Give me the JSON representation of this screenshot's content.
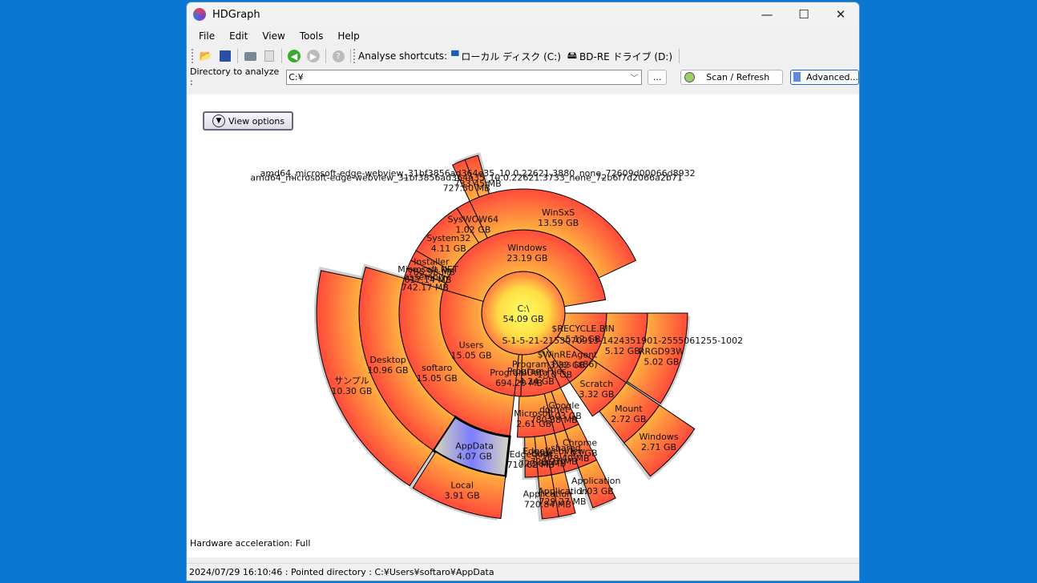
{
  "window": {
    "title": "HDGraph",
    "controls": [
      "—",
      "☐",
      "✕"
    ]
  },
  "menu": [
    "File",
    "Edit",
    "View",
    "Tools",
    "Help"
  ],
  "toolbar": {
    "icons": [
      "open-folder-icon",
      "save-icon",
      "print-icon",
      "print-preview-icon",
      "back-icon",
      "forward-icon",
      "help-icon"
    ],
    "shortcuts_label": "Analyse shortcuts:",
    "shortcut_local": "ローカル ディスク (C:)",
    "shortcut_bd": "BD-RE ドライブ (D:)"
  },
  "directory": {
    "label": "Directory to analyze :",
    "value": "C:¥",
    "browse": "...",
    "scan": "Scan / Refresh",
    "advanced": "Advanced..."
  },
  "view_options": "View options",
  "hardware": "Hardware acceleration: Full",
  "status": "2024/07/29 16:10:46 : Pointed directory : C:¥Users¥softaro¥AppData",
  "chart_data": {
    "type": "sunburst",
    "unit_total_gb": 54.09,
    "highlight": "AppData",
    "colors": {
      "inner": "#ffff66",
      "ring_in": "#ffb040",
      "ring_out": "#ff4a3a",
      "highlight": "#7d7dff",
      "shadow": "#a0a0a0"
    },
    "root": {
      "name": "C:\\",
      "size": "54.09 GB",
      "gb": 54.09,
      "children": [
        {
          "name": "$RECYCLE.BIN",
          "size": "5.12 GB",
          "gb": 5.12,
          "children": [
            {
              "name": "S-1-5-21-2153070913-1424351901-2555061255-1002",
              "size": "5.12 GB",
              "gb": 5.12,
              "children": [
                {
                  "name": "RRGD93W",
                  "size": "5.02 GB",
                  "gb": 5.02,
                  "children": []
                }
              ]
            }
          ]
        },
        {
          "name": "$WinREAgent",
          "size": "3.32 GB",
          "gb": 3.32,
          "children": [
            {
              "name": "Scratch",
              "size": "3.32 GB",
              "gb": 3.32,
              "children": [
                {
                  "name": "Mount",
                  "size": "2.72 GB",
                  "gb": 2.72,
                  "children": [
                    {
                      "name": "Windows",
                      "size": "2.71 GB",
                      "gb": 2.71,
                      "children": []
                    }
                  ]
                }
              ]
            }
          ]
        },
        {
          "name": "Program Files (x86)",
          "size": "1.10 GB",
          "gb": 1.1,
          "children": []
        },
        {
          "name": "Program Files",
          "size": "4.24 GB",
          "gb": 4.24,
          "children": [
            {
              "name": "Google",
              "size": "1.03 GB",
              "gb": 1.03,
              "children": [
                {
                  "name": "Chrome",
                  "size": "1.03 GB",
                  "gb": 1.03,
                  "children": [
                    {
                      "name": "Application",
                      "size": "1.03 GB",
                      "gb": 1.03,
                      "children": []
                    }
                  ]
                }
              ]
            },
            {
              "name": "dotnet",
              "size": "780.38 MB",
              "gb": 0.76,
              "children": [
                {
                  "name": "shared",
                  "size": "778.40 MB",
                  "gb": 0.76,
                  "children": []
                }
              ]
            },
            {
              "name": "Microsoft",
              "size": "2.61 GB",
              "gb": 2.61,
              "children": [
                {
                  "name": "EdgeWebView",
                  "size": "729.27 MB",
                  "gb": 0.71,
                  "children": [
                    {
                      "name": "Application",
                      "size": "729.27 MB",
                      "gb": 0.71,
                      "children": []
                    }
                  ]
                },
                {
                  "name": "Edge",
                  "size": "720.84 MB",
                  "gb": 0.7,
                  "children": [
                    {
                      "name": "Application",
                      "size": "720.84 MB",
                      "gb": 0.7,
                      "children": []
                    }
                  ]
                },
                {
                  "name": "EdgeCore",
                  "size": "710.62 MB",
                  "gb": 0.69,
                  "children": []
                }
              ]
            }
          ]
        },
        {
          "name": "ProgramData",
          "size": "694.20 MB",
          "gb": 0.68,
          "children": []
        },
        {
          "name": "Users",
          "size": "15.05 GB",
          "gb": 15.05,
          "children": [
            {
              "name": "softaro",
              "size": "15.05 GB",
              "gb": 15.05,
              "children": [
                {
                  "name": "AppData",
                  "size": "4.07 GB",
                  "gb": 4.07,
                  "children": [
                    {
                      "name": "Local",
                      "size": "3.91 GB",
                      "gb": 3.91,
                      "children": []
                    }
                  ]
                },
                {
                  "name": "Desktop",
                  "size": "10.96 GB",
                  "gb": 10.96,
                  "children": [
                    {
                      "name": "サンプル",
                      "size": "10.30 GB",
                      "gb": 10.3,
                      "children": []
                    }
                  ]
                }
              ]
            }
          ]
        },
        {
          "name": "Windows",
          "size": "23.19 GB",
          "gb": 23.19,
          "children": [
            {
              "name": "assembly",
              "size": "742.17 MB",
              "gb": 0.72,
              "children": []
            },
            {
              "name": "Microsoft.NET",
              "size": "617.14 MB",
              "gb": 0.6,
              "children": []
            },
            {
              "name": "Installer",
              "size": "785.98 MB",
              "gb": 0.77,
              "children": []
            },
            {
              "name": "System32",
              "size": "4.11 GB",
              "gb": 4.11,
              "children": []
            },
            {
              "name": "SysWOW64",
              "size": "1.02 GB",
              "gb": 1.02,
              "children": []
            },
            {
              "name": "WinSxS",
              "size": "13.59 GB",
              "gb": 13.59,
              "children": [
                {
                  "name": "amd64_microsoft-edge-webview_31bf3856ad364e35_10.0.22621.3733_none_72b6f7d2066a2b71",
                  "size": "727.50 MB",
                  "gb": 0.71,
                  "children": []
                },
                {
                  "name": "amd64_microsoft-edge-webview_31bf3856ad364e35_10.0.22621.3880_none_72609d00066d8932",
                  "size": "733.45 MB",
                  "gb": 0.72,
                  "children": []
                }
              ]
            }
          ]
        }
      ]
    }
  }
}
